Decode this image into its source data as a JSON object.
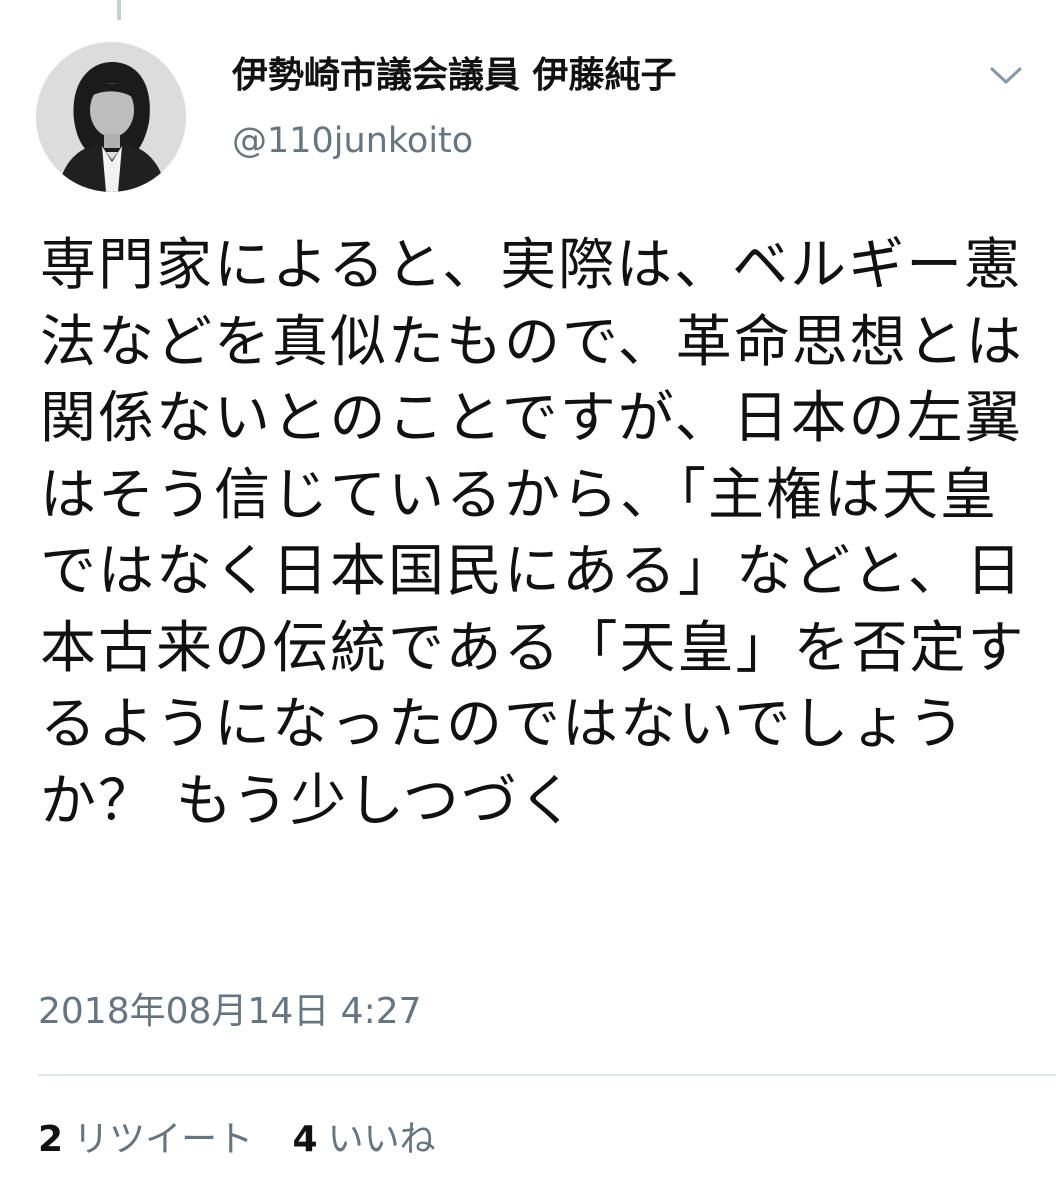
{
  "tweet": {
    "display_name": "伊勢崎市議会議員 伊藤純子",
    "handle": "@110junkoito",
    "text": "専門家によると、実際は、ベルギー憲法などを真似たもので、革命思想とは関係ないとのことですが、日本の左翼はそう信じているから、「主権は天皇ではなく日本国民にある」などと、日本古来の伝統である「天皇」を否定するようになったのではないでしょうか？ もう少しつづく",
    "timestamp": "2018年08月14日 4:27"
  },
  "stats": {
    "retweets": {
      "count": "2",
      "label": "リツイート"
    },
    "likes": {
      "count": "4",
      "label": "いいね"
    }
  },
  "icons": {
    "avatar": "profile-photo",
    "menu": "chevron-down-icon"
  },
  "colors": {
    "text": "#111111",
    "secondary": "#66757f",
    "divider": "#e1e8ed"
  }
}
